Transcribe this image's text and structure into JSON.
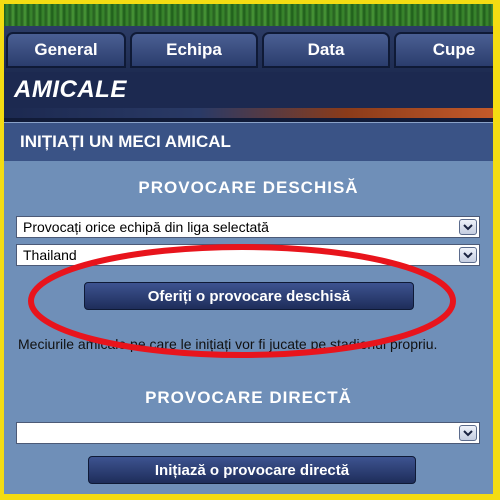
{
  "tabs": [
    {
      "label": "General"
    },
    {
      "label": "Echipa"
    },
    {
      "label": "Data"
    },
    {
      "label": "Cupe"
    }
  ],
  "section_title": "AMICALE",
  "subheading": "INIȚIAȚI UN MECI AMICAL",
  "open_challenge": {
    "heading": "PROVOCARE DESCHISĂ",
    "type_select_value": "Provocați orice echipă din liga selectată",
    "country_select_value": "Thailand",
    "button_label": "Oferiți o provocare deschisă"
  },
  "note": "Meciurile amicale pe care le inițiați vor fi jucate pe stadionul propriu.",
  "direct_challenge": {
    "heading": "PROVOCARE DIRECTĂ",
    "select_value": "",
    "button_label": "Inițiază o provocare directă"
  },
  "colors": {
    "page_border": "#f4dc12",
    "panel_bg": "#6f8fb8",
    "highlight_ellipse": "#e8141c"
  }
}
